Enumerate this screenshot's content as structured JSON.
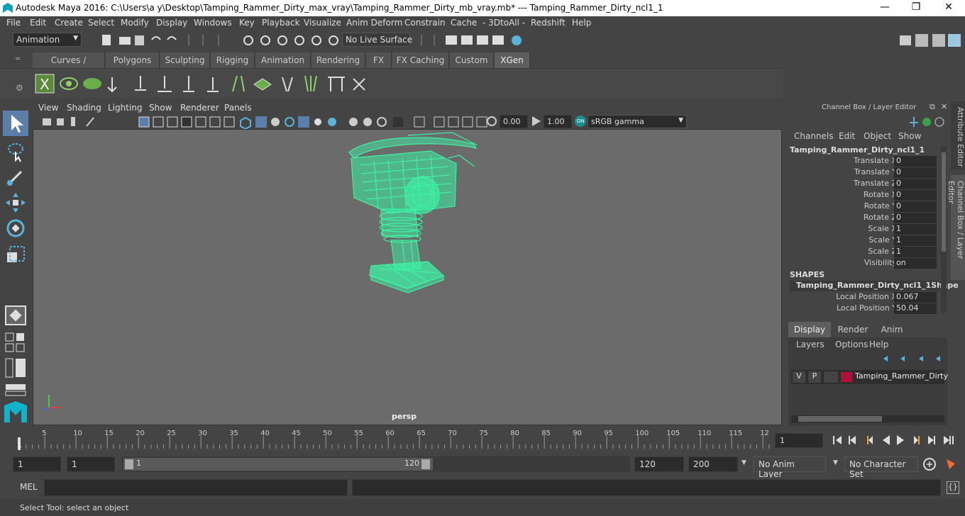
{
  "window": {
    "title": "Autodesk Maya 2016: C:\\Users\\a y\\Desktop\\Tamping_Rammer_Dirty_max_vray\\Tamping_Rammer_Dirty_mb_vray.mb*   ---   Tamping_Rammer_Dirty_ncl1_1",
    "min": "—",
    "max": "❐",
    "close": "✕"
  },
  "menu": [
    "File",
    "Edit",
    "Create",
    "Select",
    "Modify",
    "Display",
    "Windows",
    "Key",
    "Playback",
    "Visualize",
    "Anim Deform",
    "Constrain",
    "Cache",
    "- 3DtoAll -",
    "Redshift",
    "Help"
  ],
  "statusline": {
    "mode": "Animation",
    "live_surface": "No Live Surface"
  },
  "shelf_tabs": [
    "Curves / Surfaces",
    "Polygons",
    "Sculpting",
    "Rigging",
    "Animation",
    "Rendering",
    "FX",
    "FX Caching",
    "Custom",
    "XGen"
  ],
  "active_shelf_tab": "XGen",
  "viewport": {
    "menu": [
      "View",
      "Shading",
      "Lighting",
      "Show",
      "Renderer",
      "Panels"
    ],
    "exposure": "0.00",
    "gamma": "1.00",
    "color_space": "sRGB gamma",
    "camera_label": "persp",
    "wire_color": "#3df2a4"
  },
  "channel_box": {
    "header": "Channel Box / Layer Editor",
    "menu": [
      "Channels",
      "Edit",
      "Object",
      "Show"
    ],
    "object_name": "Tamping_Rammer_Dirty_ncl1_1",
    "channels": [
      {
        "label": "Translate X",
        "value": "0"
      },
      {
        "label": "Translate Y",
        "value": "0"
      },
      {
        "label": "Translate Z",
        "value": "0"
      },
      {
        "label": "Rotate X",
        "value": "0"
      },
      {
        "label": "Rotate Y",
        "value": "0"
      },
      {
        "label": "Rotate Z",
        "value": "0"
      },
      {
        "label": "Scale X",
        "value": "1"
      },
      {
        "label": "Scale Y",
        "value": "1"
      },
      {
        "label": "Scale Z",
        "value": "1"
      },
      {
        "label": "Visibility",
        "value": "on"
      }
    ],
    "shapes_header": "SHAPES",
    "shape_name": "Tamping_Rammer_Dirty_ncl1_1Shape",
    "shape_channels": [
      {
        "label": "Local Position X",
        "value": "0.067"
      },
      {
        "label": "Local Position Y",
        "value": "50.04"
      }
    ]
  },
  "side_tabs": {
    "attribute_editor": "Attribute Editor",
    "channel_box": "Channel Box / Layer Editor"
  },
  "layer_editor": {
    "tabs": [
      "Display",
      "Render",
      "Anim"
    ],
    "active_tab": "Display",
    "menu": [
      "Layers",
      "Options",
      "Help"
    ],
    "layer": {
      "v": "V",
      "p": "P",
      "name": "Tamping_Rammer_Dirty",
      "color": "#b0103a"
    }
  },
  "timeline": {
    "ticks": [
      "5",
      "10",
      "15",
      "20",
      "25",
      "30",
      "35",
      "40",
      "45",
      "50",
      "55",
      "60",
      "65",
      "70",
      "75",
      "80",
      "85",
      "90",
      "95",
      "100",
      "105",
      "110",
      "115",
      "12"
    ],
    "start_label": "1",
    "current_frame": "1"
  },
  "range": {
    "start": "1",
    "playback_start": "1",
    "slider_start": "1",
    "slider_end": "120",
    "playback_end": "120",
    "end": "200",
    "anim_layer": "No Anim Layer",
    "character_set": "No Character Set"
  },
  "command": {
    "label": "MEL"
  },
  "help_line": "Select Tool: select an object"
}
